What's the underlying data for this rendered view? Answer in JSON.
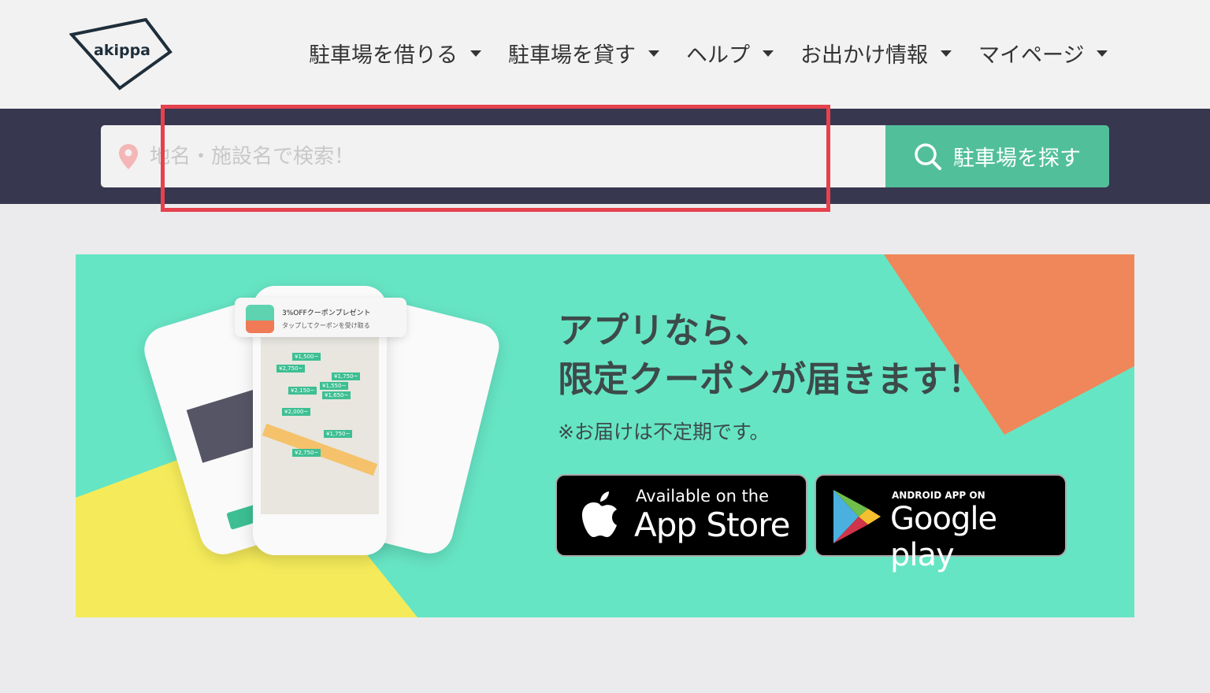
{
  "header": {
    "logo": "akippa",
    "nav": [
      {
        "label": "駐車場を借りる"
      },
      {
        "label": "駐車場を貸す"
      },
      {
        "label": "ヘルプ"
      },
      {
        "label": "お出かけ情報"
      },
      {
        "label": "マイページ"
      }
    ]
  },
  "search": {
    "placeholder": "地名・施設名で検索！",
    "value": "",
    "button_label": "駐車場を探す",
    "icon": "map-pin-icon",
    "button_icon": "search-icon"
  },
  "banner": {
    "headline_line1": "アプリなら、",
    "headline_line2": "限定クーポンが届きます！",
    "note": "※お届けは不定期です。",
    "notification_title": "3%OFFクーポンプレゼント",
    "notification_body": "タップしてクーポンを受け取る",
    "price_tags": [
      "¥1,500~",
      "¥2,750~",
      "¥1,750~",
      "¥1,550~",
      "¥2,150~",
      "¥1,650~",
      "¥2,000~",
      "¥1,750~",
      "¥2,750~"
    ],
    "app_store": {
      "small": "Available on the",
      "large": "App Store"
    },
    "google_play": {
      "small": "ANDROID APP ON",
      "large": "Google play"
    },
    "colors": {
      "teal": "#66e5c4",
      "orange": "#f0875a",
      "yellow": "#f5eb5a"
    }
  },
  "colors": {
    "band": "#383750",
    "button": "#52bf9b",
    "annotation": "#e5424d"
  }
}
